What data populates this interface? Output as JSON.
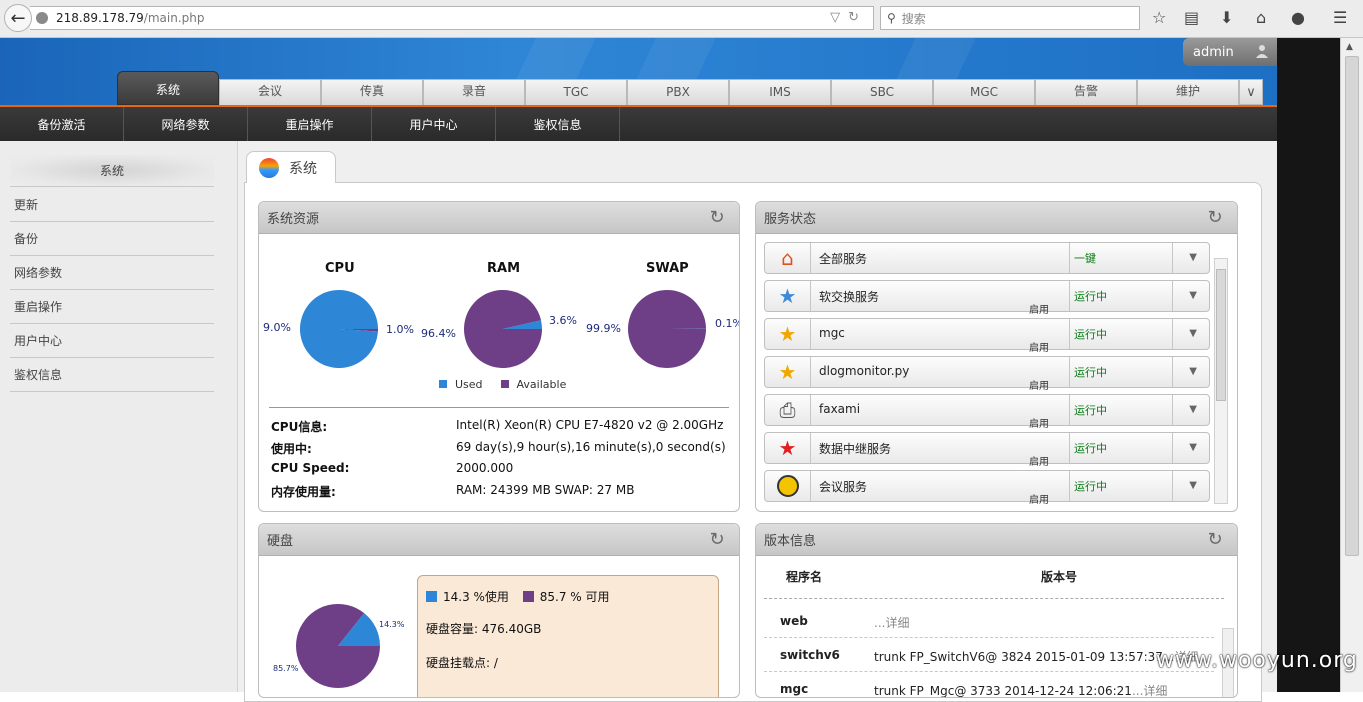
{
  "browser": {
    "url_host": "218.89.178.79",
    "url_path": "/main.php",
    "search_placeholder": "搜索"
  },
  "header": {
    "user": "admin",
    "tabs": [
      {
        "label": "系统",
        "active": true
      },
      {
        "label": "会议"
      },
      {
        "label": "传真"
      },
      {
        "label": "录音"
      },
      {
        "label": "TGC"
      },
      {
        "label": "PBX"
      },
      {
        "label": "IMS"
      },
      {
        "label": "SBC"
      },
      {
        "label": "MGC"
      },
      {
        "label": "告警"
      },
      {
        "label": "维护"
      }
    ]
  },
  "subnav": [
    "备份激活",
    "网络参数",
    "重启操作",
    "用户中心",
    "鉴权信息"
  ],
  "sidebar": {
    "title": "系统",
    "items": [
      "更新",
      "备份",
      "网络参数",
      "重启操作",
      "用户中心",
      "鉴权信息"
    ]
  },
  "page": {
    "title": "系统"
  },
  "system_resources": {
    "title": "系统资源",
    "cpu": {
      "title": "CPU",
      "used_label": "1.0%",
      "available_label": "9.0%",
      "used": 1.0
    },
    "ram": {
      "title": "RAM",
      "used_label": "3.6%",
      "available_label": "96.4%",
      "used": 3.6
    },
    "swap": {
      "title": "SWAP",
      "used_label": "0.1%",
      "available_label": "99.9%",
      "used": 0.1
    },
    "legend": {
      "used": "Used",
      "available": "Available"
    },
    "info": [
      {
        "k": "CPU信息:",
        "v": "Intel(R) Xeon(R) CPU E7-4820 v2 @ 2.00GHz"
      },
      {
        "k": "使用中:",
        "v": "69 day(s),9 hour(s),16 minute(s),0 second(s)"
      },
      {
        "k": "CPU Speed:",
        "v": "2000.000"
      },
      {
        "k": "内存使用量:",
        "v": "RAM: 24399 MB SWAP: 27 MB"
      }
    ]
  },
  "service_status": {
    "title": "服务状态",
    "rows": [
      {
        "name": "全部服务",
        "sub": "",
        "status": "一键"
      },
      {
        "name": "软交换服务",
        "sub": "启用",
        "status": "运行中"
      },
      {
        "name": "mgc",
        "sub": "启用",
        "status": "运行中"
      },
      {
        "name": "dlogmonitor.py",
        "sub": "启用",
        "status": "运行中"
      },
      {
        "name": "faxami",
        "sub": "启用",
        "status": "运行中"
      },
      {
        "name": "数据中继服务",
        "sub": "启用",
        "status": "运行中"
      },
      {
        "name": "会议服务",
        "sub": "启用",
        "status": "运行中"
      }
    ]
  },
  "disk": {
    "title": "硬盘",
    "used_pct": 14.3,
    "used_label": "14.3%",
    "avail_label": "85.7%",
    "legend_used": "14.3 %使用",
    "legend_avail": "85.7 % 可用",
    "capacity": "硬盘容量: 476.40GB",
    "mount": "硬盘挂载点: /"
  },
  "version": {
    "title": "版本信息",
    "col_name": "程序名",
    "col_ver": "版本号",
    "rows": [
      {
        "name": "web",
        "ver": "",
        "more": "...详细"
      },
      {
        "name": "switchv6",
        "ver": "trunk FP_SwitchV6@ 3824 2015-01-09 13:57:37",
        "more": "...详细"
      },
      {
        "name": "mgc",
        "ver": "trunk FP_Mgc@ 3733 2014-12-24 12:06:21",
        "more": "...详细"
      }
    ]
  },
  "colors": {
    "used": "#2e86d6",
    "available": "#6e3f86",
    "accent": "#e7670e"
  },
  "watermark": "www.wooyun.org"
}
